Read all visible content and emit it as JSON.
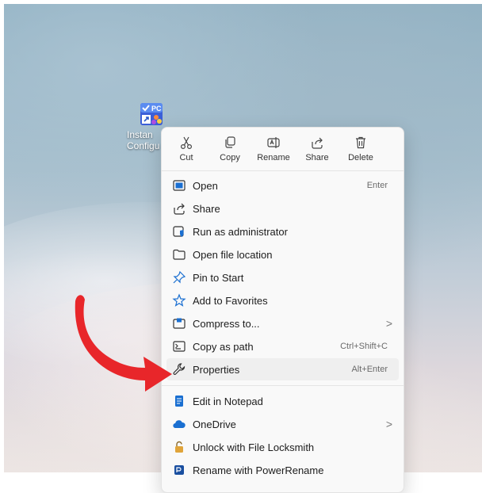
{
  "desktop": {
    "icon_label": "Instan\nConfigu"
  },
  "toolbar": [
    {
      "label": "Cut",
      "icon": "scissors-icon"
    },
    {
      "label": "Copy",
      "icon": "copy-icon"
    },
    {
      "label": "Rename",
      "icon": "rename-icon"
    },
    {
      "label": "Share",
      "icon": "share-icon"
    },
    {
      "label": "Delete",
      "icon": "trash-icon"
    }
  ],
  "menu": [
    {
      "label": "Open",
      "shortcut": "Enter",
      "icon": "open-window-icon"
    },
    {
      "label": "Share",
      "shortcut": "",
      "icon": "share-icon"
    },
    {
      "label": "Run as administrator",
      "shortcut": "",
      "icon": "admin-shield-icon"
    },
    {
      "label": "Open file location",
      "shortcut": "",
      "icon": "folder-icon"
    },
    {
      "label": "Pin to Start",
      "shortcut": "",
      "icon": "pin-icon"
    },
    {
      "label": "Add to Favorites",
      "shortcut": "",
      "icon": "star-icon"
    },
    {
      "label": "Compress to...",
      "shortcut": "",
      "icon": "archive-icon",
      "submenu": ">"
    },
    {
      "label": "Copy as path",
      "shortcut": "Ctrl+Shift+C",
      "icon": "path-icon"
    },
    {
      "label": "Properties",
      "shortcut": "Alt+Enter",
      "icon": "wrench-icon",
      "highlighted": true
    },
    {
      "label": "Edit in Notepad",
      "shortcut": "",
      "icon": "notepad-icon"
    },
    {
      "label": "OneDrive",
      "shortcut": "",
      "icon": "cloud-icon",
      "submenu": ">"
    },
    {
      "label": "Unlock with File Locksmith",
      "shortcut": "",
      "icon": "lock-icon"
    },
    {
      "label": "Rename with PowerRename",
      "shortcut": "",
      "icon": "powerrename-icon"
    }
  ],
  "colors": {
    "arrow": "#e8262a",
    "accent": "#1a6fd1"
  }
}
